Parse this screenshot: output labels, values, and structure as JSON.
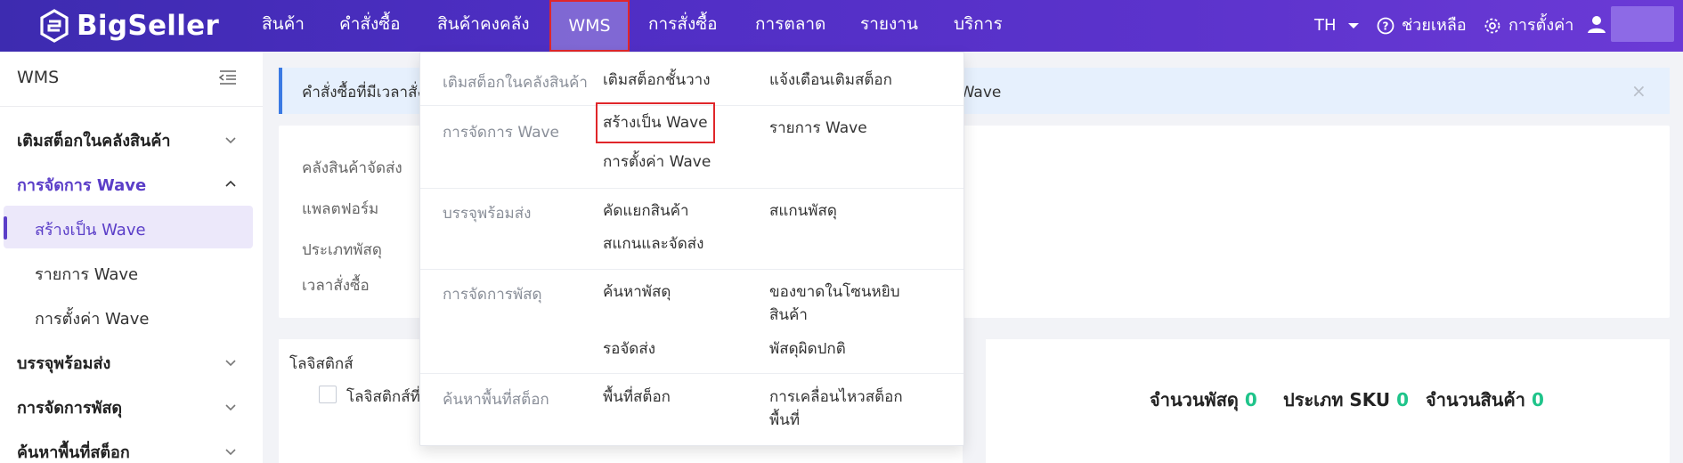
{
  "app": {
    "logo_text": "BigSeller",
    "brand_color": "#4f2ec4",
    "accent_color": "#5b3ec8",
    "highlight_color": "#e0262a",
    "stat_color": "#1fc48a"
  },
  "nav": {
    "items": [
      {
        "label": "สินค้า"
      },
      {
        "label": "คำสั่งซื้อ"
      },
      {
        "label": "สินค้าคงคลัง"
      },
      {
        "label": "WMS"
      },
      {
        "label": "การสั่งซื้อ"
      },
      {
        "label": "การตลาด"
      },
      {
        "label": "รายงาน"
      },
      {
        "label": "บริการ"
      }
    ],
    "language": "TH",
    "help_label": "ช่วยเหลือ",
    "settings_label": "การตั้งค่า"
  },
  "sidebar": {
    "title": "WMS",
    "sections": [
      {
        "label": "เติมสต็อกในคลังสินค้า"
      },
      {
        "label": "การจัดการ Wave",
        "sub": [
          "สร้างเป็น Wave",
          "รายการ Wave",
          "การตั้งค่า Wave"
        ]
      },
      {
        "label": "บรรจุพร้อมส่ง"
      },
      {
        "label": "การจัดการพัสดุ"
      },
      {
        "label": "ค้นหาพื้นที่สต็อก"
      }
    ]
  },
  "notice": {
    "text": "คำสั่งซื้อที่มีเวลาสั่ง",
    "tail": "ง Wave",
    "close_icon": "×"
  },
  "filters": {
    "labels": [
      "คลังสินค้าจัดส่ง",
      "แพลตฟอร์ม",
      "ประเภทพัสดุ",
      "เวลาสั่งซื้อ"
    ]
  },
  "logistics": {
    "title": "โลจิสติกส์",
    "option_label": "โลจิสติกส์ที่"
  },
  "stats": {
    "parcels_label": "จำนวนพัสดุ",
    "parcels_value": "0",
    "sku_label": "ประเภท SKU",
    "sku_value": "0",
    "items_label": "จำนวนสินค้า",
    "items_value": "0"
  },
  "dropdown": {
    "groups": [
      {
        "title": "เติมสต็อกในคลังสินค้า",
        "links": [
          "เติมสต็อกชั้นวาง",
          "แจ้งเตือนเติมสต็อก"
        ]
      },
      {
        "title": "การจัดการ Wave",
        "links": [
          "สร้างเป็น Wave",
          "รายการ Wave",
          "การตั้งค่า Wave"
        ]
      },
      {
        "title": "บรรจุพร้อมส่ง",
        "links": [
          "คัดแยกสินค้า",
          "สแกนพัสดุ",
          "สแกนและจัดส่ง"
        ]
      },
      {
        "title": "การจัดการพัสดุ",
        "links": [
          "ค้นหาพัสดุ",
          "ของขาดในโซนหยิบ",
          "สินค้า",
          "รอจัดส่ง",
          "พัสดุผิดปกติ"
        ]
      },
      {
        "title": "ค้นหาพื้นที่สต็อก",
        "links": [
          "พื้นที่สต็อก",
          "การเคลื่อนไหวสต็อก",
          "พื้นที่"
        ]
      }
    ]
  }
}
